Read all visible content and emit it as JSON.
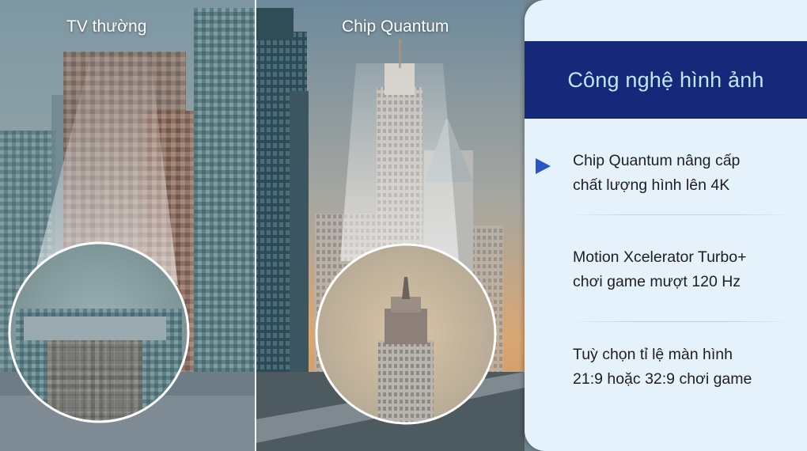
{
  "comparison": {
    "left_label": "TV thường",
    "right_label": "Chip Quantum"
  },
  "panel": {
    "title": "Công nghệ hình ảnh",
    "features": [
      {
        "line1": "Chip Quantum nâng cấp",
        "line2": "chất lượng hình lên 4K",
        "active": true
      },
      {
        "line1": "Motion Xcelerator Turbo+",
        "line2": "chơi game mượt 120 Hz",
        "active": false
      },
      {
        "line1": "Tuỳ chọn tỉ lệ màn hình",
        "line2": "21:9 hoặc 32:9 chơi game",
        "active": false
      }
    ]
  },
  "colors": {
    "header_bg": "#16287a",
    "header_text": "#bfe8f6",
    "panel_bg": "#e6f2fb",
    "arrow": "#2a54c8"
  }
}
